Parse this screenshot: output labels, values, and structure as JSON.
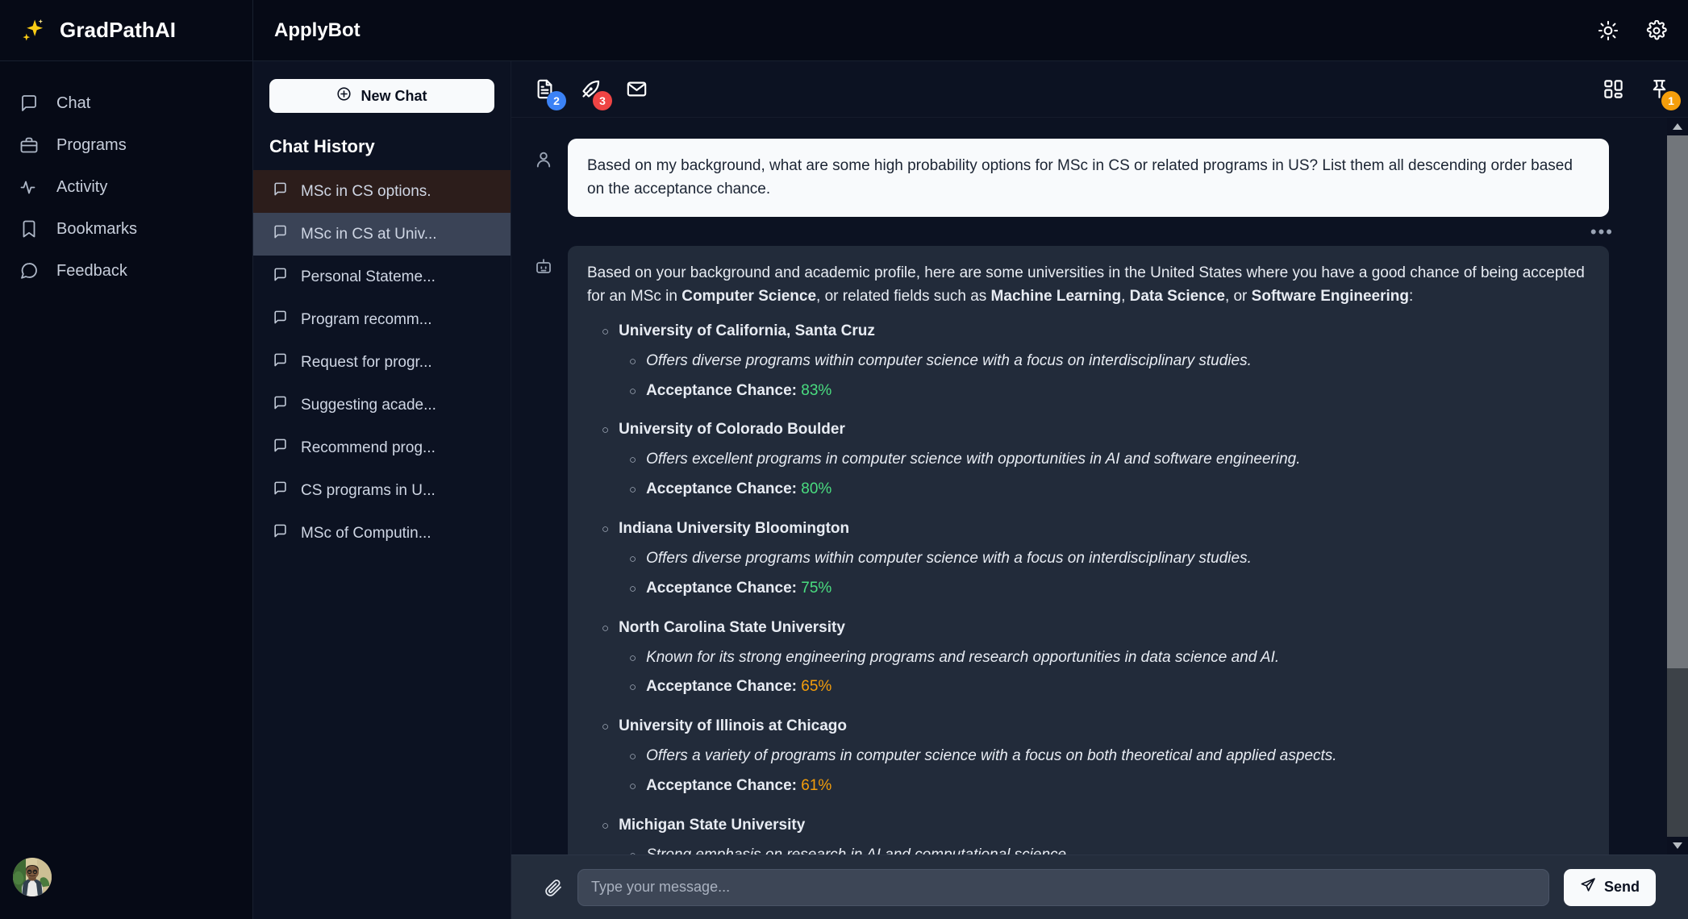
{
  "brand": {
    "name": "GradPathAI",
    "logo_icon": "sparkle-icon"
  },
  "header": {
    "app_title": "ApplyBot",
    "theme_toggle_icon": "sun-icon",
    "settings_icon": "gear-icon"
  },
  "sidebar": {
    "items": [
      {
        "label": "Chat",
        "icon": "chat-bubble-icon"
      },
      {
        "label": "Programs",
        "icon": "briefcase-icon"
      },
      {
        "label": "Activity",
        "icon": "activity-pulse-icon"
      },
      {
        "label": "Bookmarks",
        "icon": "bookmark-icon"
      },
      {
        "label": "Feedback",
        "icon": "message-circle-icon"
      }
    ],
    "avatar_alt": "user-avatar"
  },
  "history_panel": {
    "new_chat_label": "New Chat",
    "new_chat_icon": "plus-circle-icon",
    "title": "Chat History",
    "items": [
      {
        "label": "MSc in CS options.",
        "state": "accent"
      },
      {
        "label": "MSc in CS at Univ...",
        "state": "selected"
      },
      {
        "label": "Personal Stateme...",
        "state": "normal"
      },
      {
        "label": "Program recomm...",
        "state": "normal"
      },
      {
        "label": "Request for progr...",
        "state": "normal"
      },
      {
        "label": "Suggesting acade...",
        "state": "normal"
      },
      {
        "label": "Recommend prog...",
        "state": "normal"
      },
      {
        "label": "CS programs in U...",
        "state": "normal"
      },
      {
        "label": "MSc of Computin...",
        "state": "normal"
      }
    ]
  },
  "chat_toolbar": {
    "left": [
      {
        "icon": "document-text-icon",
        "badge": "2",
        "badge_color": "blue"
      },
      {
        "icon": "pen-signature-icon",
        "badge": "3",
        "badge_color": "red"
      },
      {
        "icon": "envelope-icon",
        "badge": "",
        "badge_color": ""
      }
    ],
    "right": [
      {
        "icon": "layout-grid-icon",
        "badge": "",
        "badge_color": ""
      },
      {
        "icon": "pin-icon",
        "badge": "1",
        "badge_color": "orange"
      }
    ]
  },
  "conversation": {
    "user_message": {
      "avatar_icon": "user-icon",
      "text": "Based on my background, what are some high probability options for MSc in CS or related programs in US? List them all descending order based on the acceptance chance.",
      "more_actions": "•••"
    },
    "bot_message": {
      "avatar_icon": "bot-icon",
      "intro_pre": "Based on your background and academic profile, here are some universities in the United States where you have a good chance of being accepted for an MSc in ",
      "intro_b1": "Computer Science",
      "intro_mid1": ", or related fields such as ",
      "intro_b2": "Machine Learning",
      "intro_mid2": ", ",
      "intro_b3": "Data Science",
      "intro_mid3": ", or ",
      "intro_b4": "Software Engineering",
      "intro_end": ":",
      "chance_label": "Acceptance Chance:",
      "universities": [
        {
          "name": "University of California, Santa Cruz",
          "description": "Offers diverse programs within computer science with a focus on interdisciplinary studies.",
          "chance": "83%",
          "chance_tone": "green"
        },
        {
          "name": "University of Colorado Boulder",
          "description": "Offers excellent programs in computer science with opportunities in AI and software engineering.",
          "chance": "80%",
          "chance_tone": "green"
        },
        {
          "name": "Indiana University Bloomington",
          "description": "Offers diverse programs within computer science with a focus on interdisciplinary studies.",
          "chance": "75%",
          "chance_tone": "green"
        },
        {
          "name": "North Carolina State University",
          "description": "Known for its strong engineering programs and research opportunities in data science and AI.",
          "chance": "65%",
          "chance_tone": "orange"
        },
        {
          "name": "University of Illinois at Chicago",
          "description": "Offers a variety of programs in computer science with a focus on both theoretical and applied aspects.",
          "chance": "61%",
          "chance_tone": "orange"
        },
        {
          "name": "Michigan State University",
          "description": "Strong emphasis on research in AI and computational science.",
          "chance": "",
          "chance_tone": "orange"
        }
      ]
    }
  },
  "composer": {
    "attach_icon": "paperclip-icon",
    "input_value": "",
    "input_placeholder": "Type your message...",
    "send_label": "Send",
    "send_icon": "send-plane-icon"
  },
  "colors": {
    "app_bg": "#050914",
    "panel_bg": "#0c1222",
    "bubble_bot": "#222b3a",
    "bubble_user": "#f8fafc",
    "accent_row": "#2c1d1b",
    "selected_row": "#3a4356",
    "badge_blue": "#3b82f6",
    "badge_red": "#ef4444",
    "badge_orange": "#f59e0b",
    "pct_green": "#4ade80",
    "pct_orange": "#f59e0b",
    "logo_yellow": "#facc15"
  }
}
